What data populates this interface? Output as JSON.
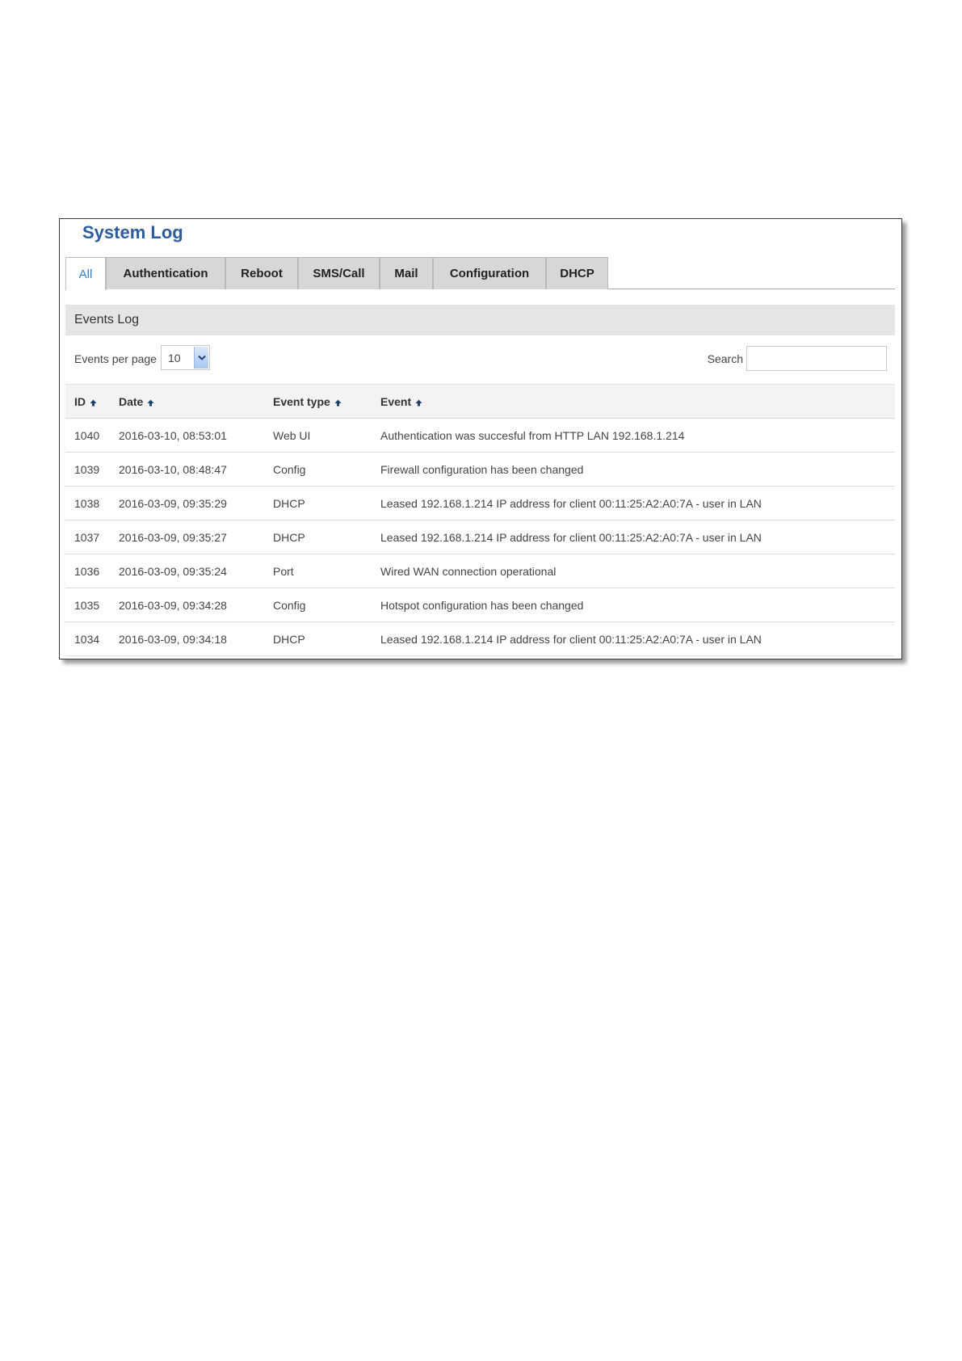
{
  "page": {
    "title": "System Log"
  },
  "tabs": [
    {
      "label": "All",
      "active": true
    },
    {
      "label": "Authentication",
      "active": false
    },
    {
      "label": "Reboot",
      "active": false
    },
    {
      "label": "SMS/Call",
      "active": false
    },
    {
      "label": "Mail",
      "active": false
    },
    {
      "label": "Configuration",
      "active": false
    },
    {
      "label": "DHCP",
      "active": false
    }
  ],
  "section": {
    "title": "Events Log"
  },
  "controls": {
    "events_per_page_label": "Events per page",
    "events_per_page_value": "10",
    "search_label": "Search",
    "search_value": ""
  },
  "table": {
    "columns": [
      "ID",
      "Date",
      "Event type",
      "Event"
    ],
    "rows": [
      {
        "id": "1040",
        "date": "2016-03-10, 08:53:01",
        "type": "Web UI",
        "event": "Authentication was succesful from HTTP LAN 192.168.1.214"
      },
      {
        "id": "1039",
        "date": "2016-03-10, 08:48:47",
        "type": "Config",
        "event": "Firewall configuration has been changed"
      },
      {
        "id": "1038",
        "date": "2016-03-09, 09:35:29",
        "type": "DHCP",
        "event": "Leased 192.168.1.214 IP address for client 00:11:25:A2:A0:7A - user in LAN"
      },
      {
        "id": "1037",
        "date": "2016-03-09, 09:35:27",
        "type": "DHCP",
        "event": "Leased 192.168.1.214 IP address for client 00:11:25:A2:A0:7A - user in LAN"
      },
      {
        "id": "1036",
        "date": "2016-03-09, 09:35:24",
        "type": "Port",
        "event": "Wired WAN connection operational"
      },
      {
        "id": "1035",
        "date": "2016-03-09, 09:34:28",
        "type": "Config",
        "event": "Hotspot configuration has been changed"
      },
      {
        "id": "1034",
        "date": "2016-03-09, 09:34:18",
        "type": "DHCP",
        "event": "Leased 192.168.1.214 IP address for client 00:11:25:A2:A0:7A - user in LAN"
      }
    ]
  },
  "icons": {
    "sort": "sort-up-arrow-icon",
    "dropdown": "chevron-down-icon"
  },
  "colors": {
    "title": "#2c5c9e",
    "active_tab_text": "#3a7ec4",
    "tab_background": "#d7d7d7",
    "section_header_background": "#e5e5e5",
    "sort_arrow": "#1f3f6e"
  }
}
